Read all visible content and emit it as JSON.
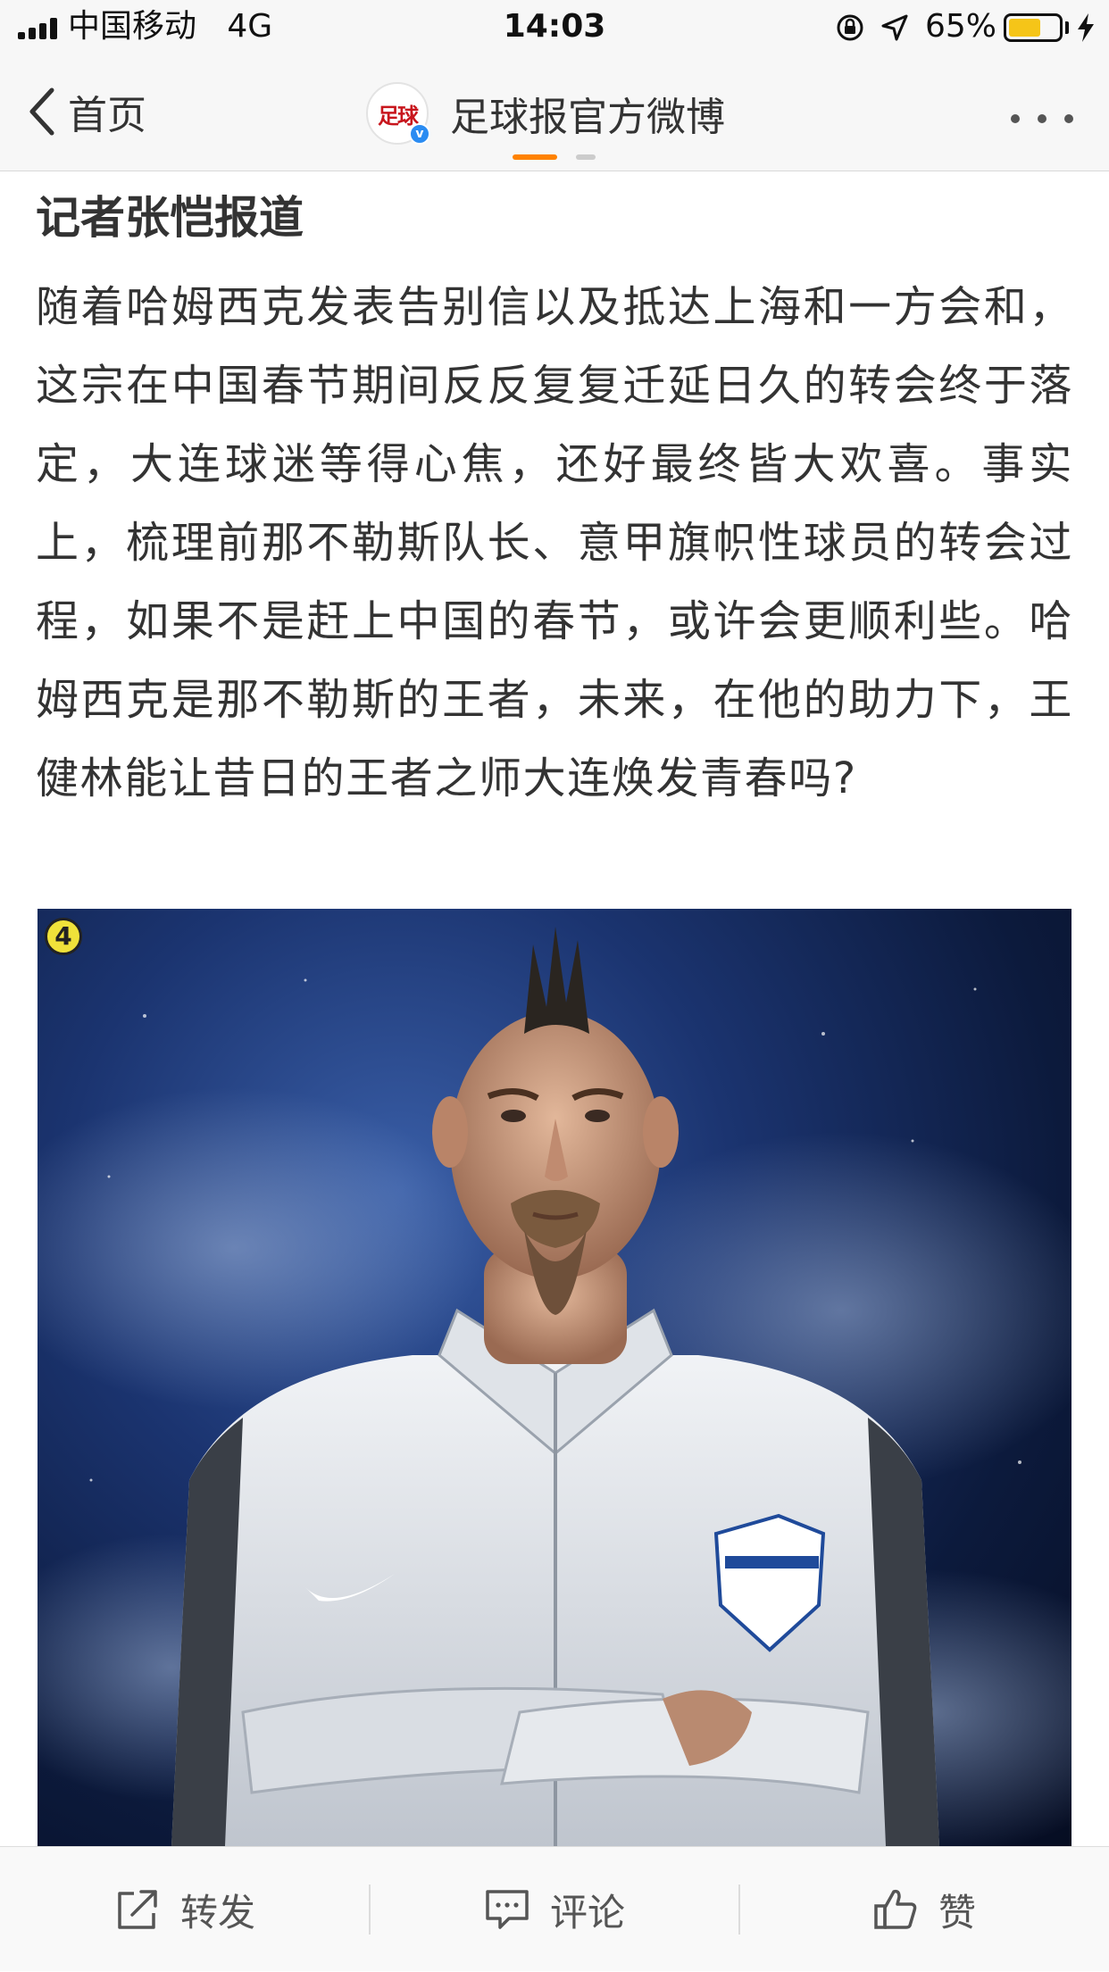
{
  "status_bar": {
    "carrier": "中国移动",
    "network": "4G",
    "time": "14:03",
    "battery_percent": "65%",
    "battery_level": 0.65,
    "battery_color": "#f5c518"
  },
  "nav": {
    "back_label": "首页",
    "account_name": "足球报官方微博",
    "avatar_text": "足球",
    "verified_mark": "v",
    "more_icon": "ellipsis-icon",
    "accent_color": "#ff8200"
  },
  "article": {
    "byline": "记者张恺报道",
    "body": "随着哈姆西克发表告别信以及抵达上海和一方会和，这宗在中国春节期间反反复复迁延日久的转会终于落定，大连球迷等得心焦，还好最终皆大欢喜。事实上，梳理前那不勒斯队长、意甲旗帜性球员的转会过程，如果不是赶上中国的春节，或许会更顺利些。哈姆西克是那不勒斯的王者，未来，在他的助力下，王健林能让昔日的王者之师大连焕发青春吗?",
    "photo_badge": "4"
  },
  "toolbar": {
    "repost_label": "转发",
    "comment_label": "评论",
    "like_label": "赞"
  }
}
